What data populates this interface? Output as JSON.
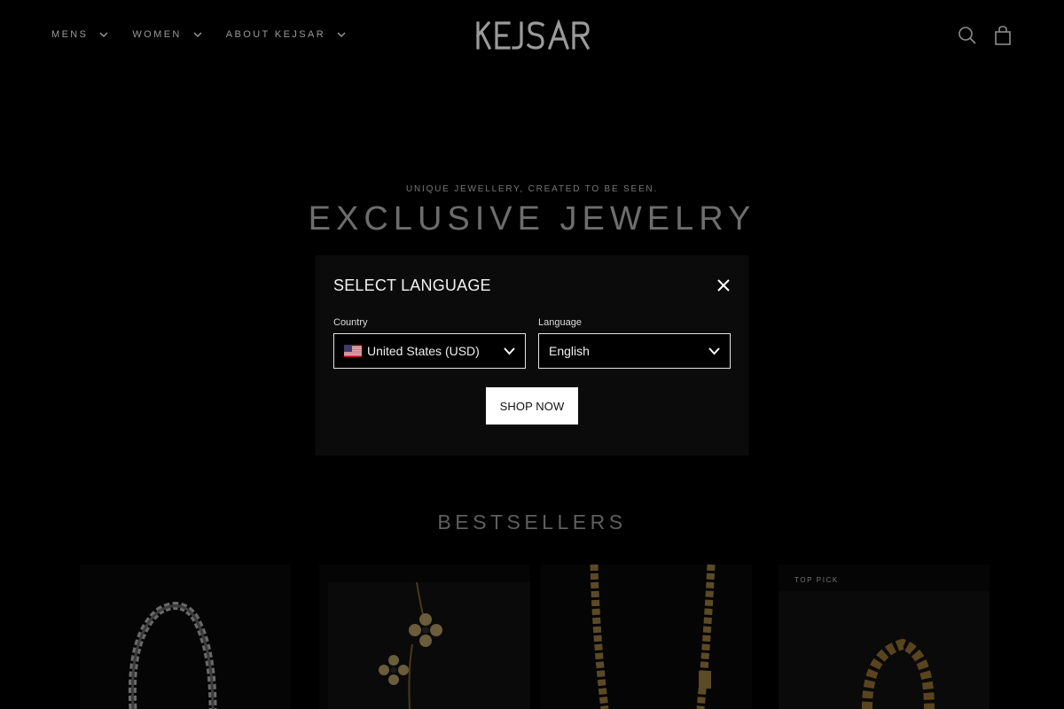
{
  "header": {
    "nav": [
      {
        "label": "MENS"
      },
      {
        "label": "WOMEN"
      },
      {
        "label": "ABOUT KEJSAR"
      }
    ],
    "logo_text": "KEJSAR",
    "icons": [
      "search-icon",
      "cart-icon"
    ]
  },
  "hero": {
    "eyebrow": "UNIQUE JEWELLERY, CREATED TO BE SEEN.",
    "title": "EXCLUSIVE JEWELRY"
  },
  "modal": {
    "title": "SELECT LANGUAGE",
    "country_label": "Country",
    "country_value": "United States (USD)",
    "language_label": "Language",
    "language_value": "English",
    "button": "SHOP NOW"
  },
  "bestsellers": {
    "title": "BESTSELLERS",
    "badge": "TOP PICK"
  },
  "colors": {
    "background": "#000000",
    "modal_bg": "#0b0b0b",
    "button_bg": "#ffffff",
    "muted_text": "#6d6d6d"
  }
}
